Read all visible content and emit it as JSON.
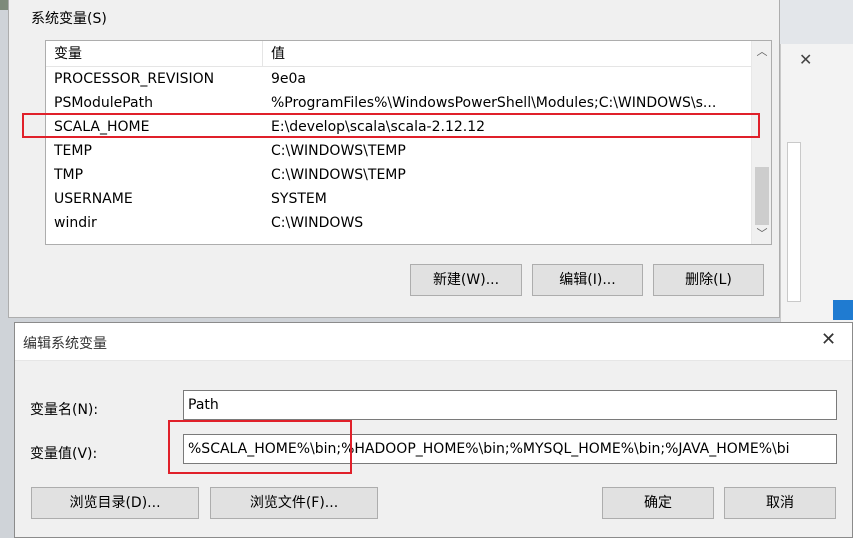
{
  "env_window": {
    "group_label": "系统变量(S)",
    "columns": [
      "变量",
      "值"
    ],
    "rows": [
      {
        "name": "PROCESSOR_REVISION",
        "value": "9e0a"
      },
      {
        "name": "PSModulePath",
        "value": "%ProgramFiles%\\WindowsPowerShell\\Modules;C:\\WINDOWS\\s..."
      },
      {
        "name": "SCALA_HOME",
        "value": "E:\\develop\\scala\\scala-2.12.12"
      },
      {
        "name": "TEMP",
        "value": "C:\\WINDOWS\\TEMP"
      },
      {
        "name": "TMP",
        "value": "C:\\WINDOWS\\TEMP"
      },
      {
        "name": "USERNAME",
        "value": "SYSTEM"
      },
      {
        "name": "windir",
        "value": "C:\\WINDOWS"
      }
    ],
    "highlighted_row": "SCALA_HOME",
    "buttons": {
      "new": "新建(W)...",
      "edit": "编辑(I)...",
      "delete": "删除(L)"
    }
  },
  "edit_dialog": {
    "title": "编辑系统变量",
    "name_label": "变量名(N):",
    "name_value": "Path",
    "value_label": "变量值(V):",
    "value_value": "%SCALA_HOME%\\bin;%HADOOP_HOME%\\bin;%MYSQL_HOME%\\bin;%JAVA_HOME%\\bi",
    "buttons": {
      "browse_dir": "浏览目录(D)...",
      "browse_file": "浏览文件(F)...",
      "ok": "确定",
      "cancel": "取消"
    }
  },
  "icons": {
    "close": "close-icon",
    "scroll_up": "chevron-up-icon",
    "scroll_down": "chevron-down-icon"
  },
  "colors": {
    "highlight": "#e0202a",
    "window_bg": "#f0f0f0",
    "button_bg": "#e1e1e1"
  }
}
